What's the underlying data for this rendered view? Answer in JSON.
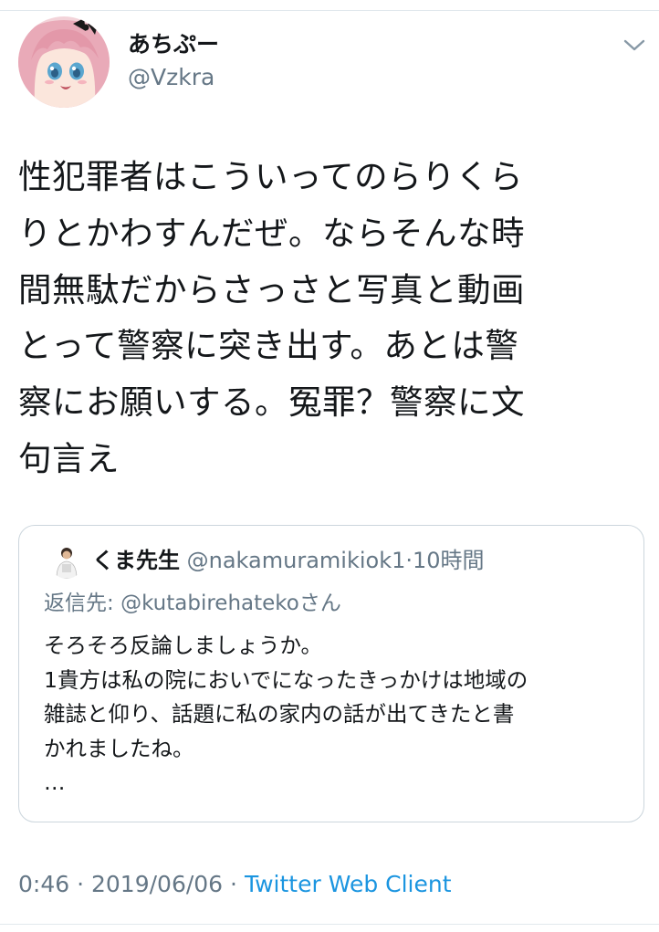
{
  "tweet": {
    "author": {
      "display_name": "あちぷー",
      "handle": "@Vzkra",
      "avatar_icon": "anime-avatar"
    },
    "text": "性犯罪者はこういってのらりくら\nりとかわすんだぜ。ならそんな時\n間無駄だからさっさと写真と動画\nとって警察に突き出す。あとは警\n察にお願いする。冤罪？警察に文\n句言え",
    "quoted": {
      "author_name": "くま先生",
      "handle": "@nakamuramikiok1",
      "separator": "·",
      "time_ago": "10時間",
      "replying_label": "返信先: ",
      "replying_to": "@kutabirehateko",
      "replying_suffix": "さん",
      "text": "そろそろ反論しましょうか。\n1貴方は私の院においでになったきっかけは地域の\n雑誌と仰り、話題に私の家内の話が出てきたと書\nかれましたね。\n…"
    },
    "time": "0:46",
    "date": "2019/06/06",
    "separator": "·",
    "client": "Twitter Web Client"
  },
  "colors": {
    "text": "#14171a",
    "secondary": "#657786",
    "link": "#1b95e0",
    "border": "#ccd6dd"
  }
}
